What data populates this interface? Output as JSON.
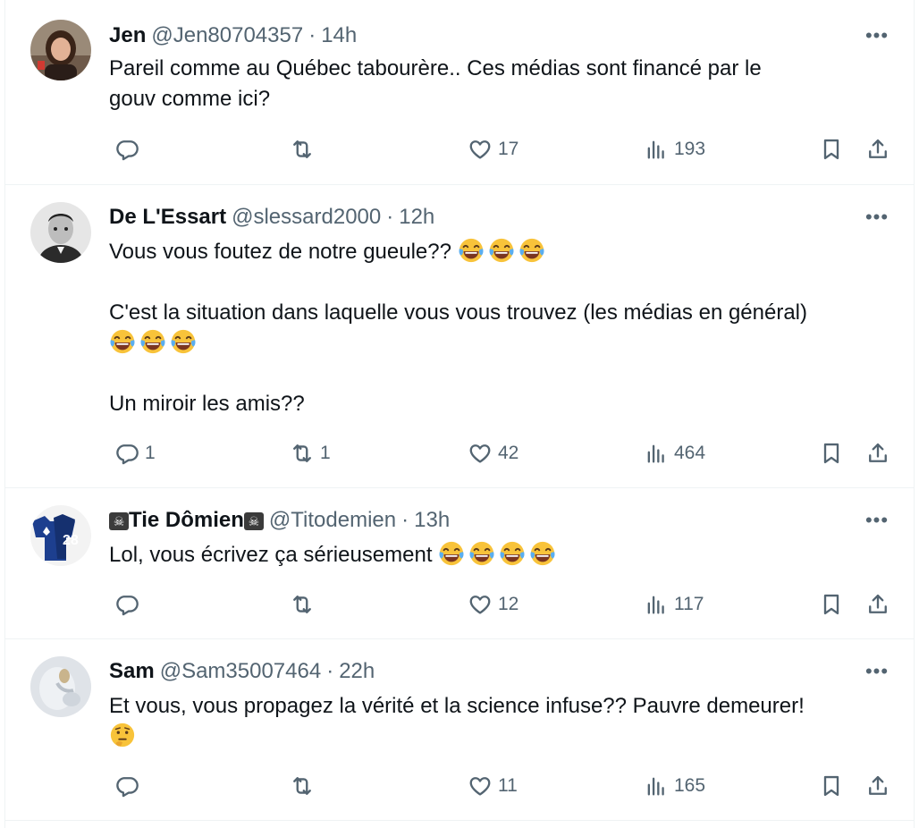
{
  "replies": [
    {
      "name": "Jen",
      "handle": "@Jen80704357",
      "time": "14h",
      "text": [
        "Pareil comme au Québec tabourère.. Ces médias sont  financé par le",
        "gouv comme ici?"
      ],
      "stats": {
        "replies": "",
        "reposts": "",
        "likes": "17",
        "views": "193"
      }
    },
    {
      "name": "De L'Essart",
      "handle": "@slessard2000",
      "time": "12h",
      "text": [
        "Vous vous foutez de notre gueule??",
        "C'est la situation dans laquelle vous vous trouvez (les médias en général)",
        "Un miroir les amis??"
      ],
      "stats": {
        "replies": "1",
        "reposts": "1",
        "likes": "42",
        "views": "464"
      }
    },
    {
      "name": "Tie Dômien",
      "handle": "@Titodemien",
      "time": "13h",
      "text": [
        "Lol, vous écrivez ça sérieusement"
      ],
      "stats": {
        "replies": "",
        "reposts": "",
        "likes": "12",
        "views": "117"
      }
    },
    {
      "name": "Sam",
      "handle": "@Sam35007464",
      "time": "22h",
      "text": [
        "Et vous, vous propagez la vérité et la science infuse?? Pauvre demeurer!"
      ],
      "stats": {
        "replies": "",
        "reposts": "",
        "likes": "11",
        "views": "165"
      }
    }
  ],
  "separator": "·",
  "more_label": "•••",
  "skull_glyph": "☠",
  "icons": [
    "reply-icon",
    "repost-icon",
    "like-icon",
    "views-icon",
    "bookmark-icon",
    "share-icon",
    "face-with-tears-of-joy-emoji",
    "thinking-face-emoji"
  ],
  "colors": {
    "text": "#0f1419",
    "secondary": "#536471",
    "border": "#eff3f4"
  }
}
